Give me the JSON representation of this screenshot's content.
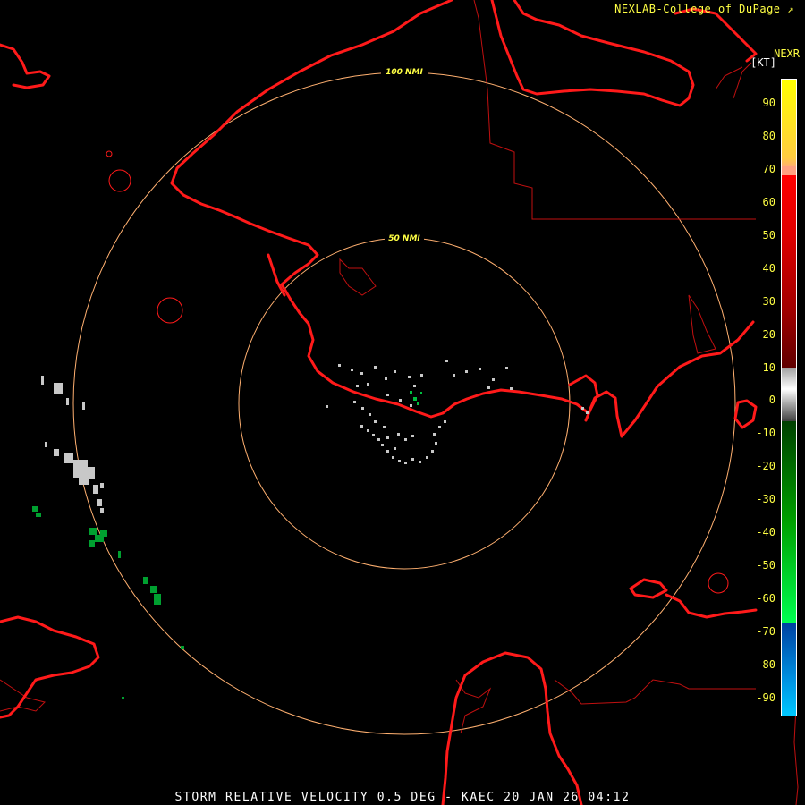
{
  "header": {
    "credit": "NEXLAB-College of DuPage",
    "credit_icon": "external-link-icon",
    "product": "NEXR",
    "units": "[KT]"
  },
  "rings": [
    {
      "label": "100 NMI",
      "range_nmi": 100
    },
    {
      "label": "50 NMI",
      "range_nmi": 50
    }
  ],
  "caption": "STORM RELATIVE VELOCITY 0.5 DEG - KAEC 20 JAN 26 04:12",
  "legend": {
    "ticks": [
      "90",
      "80",
      "70",
      "60",
      "50",
      "40",
      "30",
      "20",
      "10",
      "0",
      "-10",
      "-20",
      "-30",
      "-40",
      "-50",
      "-60",
      "-70",
      "-80",
      "-90"
    ],
    "range": [
      -100,
      100
    ],
    "colors": {
      "outbound_high": "#ffff00",
      "outbound_mid": "#ffb070",
      "outbound_red": "#ff0000",
      "outbound_dark": "#600000",
      "zero": "#c0c0c0",
      "inbound_dark": "#005000",
      "inbound_green": "#00ff40",
      "inbound_blue_dark": "#0050b0",
      "inbound_blue_light": "#00c0ff"
    }
  },
  "colors": {
    "coastline": "#ff1a1a",
    "border": "#c01010",
    "range_ring": "#ffb070",
    "ring_label": "#ffff44"
  }
}
